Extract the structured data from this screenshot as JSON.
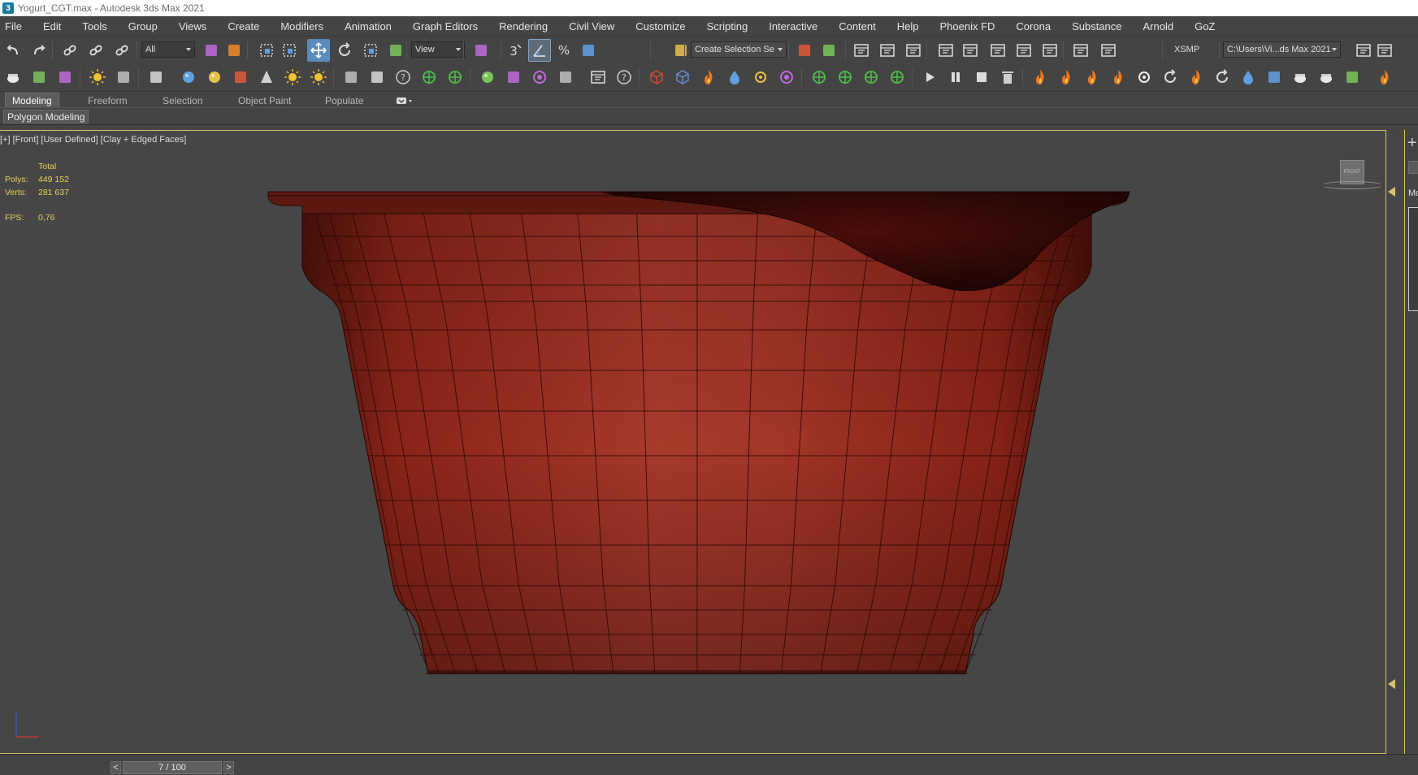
{
  "window": {
    "title": "Yogurt_CGT.max - Autodesk 3ds Max 2021",
    "app_icon": "3"
  },
  "menu": {
    "items": [
      "File",
      "Edit",
      "Tools",
      "Group",
      "Views",
      "Create",
      "Modifiers",
      "Animation",
      "Graph Editors",
      "Rendering",
      "Civil View",
      "Customize",
      "Scripting",
      "Interactive",
      "Content",
      "Help",
      "Phoenix FD",
      "Corona",
      "Substance",
      "Arnold",
      "GoZ"
    ]
  },
  "toolbar": {
    "selection_filter": "All",
    "reference_coord": "View",
    "named_selection": "Create Selection Se",
    "snap_angle_label": "3",
    "workspace_label": "XSMP",
    "project_path": "C:\\Users\\Vi...ds Max 2021"
  },
  "ribbon": {
    "tabs": [
      "Modeling",
      "Freeform",
      "Selection",
      "Object Paint",
      "Populate"
    ],
    "active_tab": "Modeling",
    "panel_label": "Polygon Modeling"
  },
  "viewport": {
    "label": "[+] [Front] [User Defined] [Clay + Edged Faces]",
    "stats": {
      "header": "Total",
      "polys_label": "Polys:",
      "polys_value": "449 152",
      "verts_label": "Verts:",
      "verts_value": "281 637",
      "fps_label": "FPS:",
      "fps_value": "0,76"
    },
    "viewcube_face": "FRONT",
    "model_color": "#9a2a1e",
    "lid_color": "#3a0c08",
    "wire_color": "#2a0805"
  },
  "sidepanel": {
    "plus": "+",
    "tab_label": "Mo"
  },
  "timeslider": {
    "prev": "<",
    "next": ">",
    "frame": "7 / 100"
  },
  "icons": {
    "toolbar1": [
      "undo-icon",
      "redo-icon",
      "link-icon",
      "unlink-icon",
      "bind-spacewarp-icon",
      "select-object-icon",
      "select-by-name-icon",
      "rect-region-icon",
      "window-crossing-icon",
      "move-icon",
      "rotate-icon",
      "scale-icon",
      "place-icon",
      "pivot-icon",
      "snap-toggle-icon",
      "angle-snap-icon",
      "percent-snap-icon",
      "spinner-snap-icon",
      "edit-named-sel-icon",
      "mirror-icon",
      "align-icon",
      "scene-explorer-icon",
      "layer-explorer-icon",
      "toggle-ribbon-icon",
      "curve-editor-icon",
      "schematic-icon",
      "material-editor-icon",
      "render-setup-icon",
      "rendered-frame-icon",
      "render-icon",
      "render-online-icon",
      "workspace-icon",
      "folder-icon"
    ],
    "toolbar2": [
      "teapot-icon",
      "box-icon",
      "plane-icon",
      "light-icon",
      "camera-icon",
      "particle-icon",
      "sphere-icon",
      "geosphere-icon",
      "torus-icon",
      "cone-icon",
      "sun-icon",
      "lightbulb-icon",
      "grid-icon",
      "bones-icon",
      "helper-icon",
      "hair-icon",
      "grass-icon",
      "sphere-render-icon",
      "color-icon",
      "media-icon",
      "script-icon",
      "scene-icon",
      "help-icon",
      "cube-red-icon",
      "cube-blue-icon",
      "fire-red-icon",
      "water-icon",
      "gear-yellow-icon",
      "circle-purple-icon",
      "network-green-icon",
      "arrow-green-icon",
      "grid-green-icon",
      "burst-green-icon",
      "play-icon",
      "pause-icon",
      "stop-icon",
      "delete-icon",
      "fire-icon",
      "fire2-icon",
      "fire3-icon",
      "fire4-icon",
      "gear-white-icon",
      "spiral-icon",
      "flame-icon",
      "swirl-icon",
      "drop-icon",
      "paint-icon",
      "cup-icon",
      "bowl-icon",
      "shell-icon",
      "fire-end-icon"
    ]
  }
}
